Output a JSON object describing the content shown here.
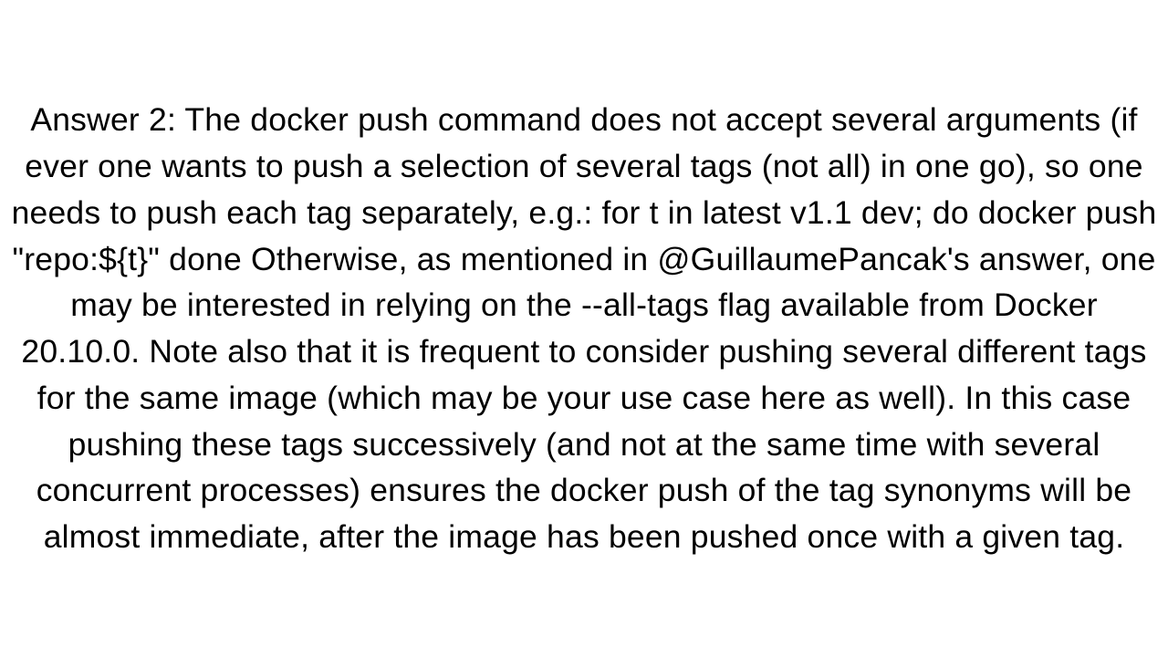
{
  "answer": {
    "text": "Answer 2: The docker push command does not accept several arguments (if ever one wants to push a selection of several tags (not all) in one go), so one needs to push each tag separately, e.g.: for t in latest v1.1 dev; do     docker push \"repo:${t}\" done  Otherwise, as mentioned in @GuillaumePancak's answer, one may be interested in relying on the --all-tags flag available from Docker 20.10.0. Note also that it is frequent to consider pushing several different tags for the same image (which may be your use case here as well). In this case pushing these tags successively (and not at the same time with several concurrent processes) ensures the docker push of the tag synonyms will be almost immediate, after the image has been pushed once with a given tag."
  }
}
